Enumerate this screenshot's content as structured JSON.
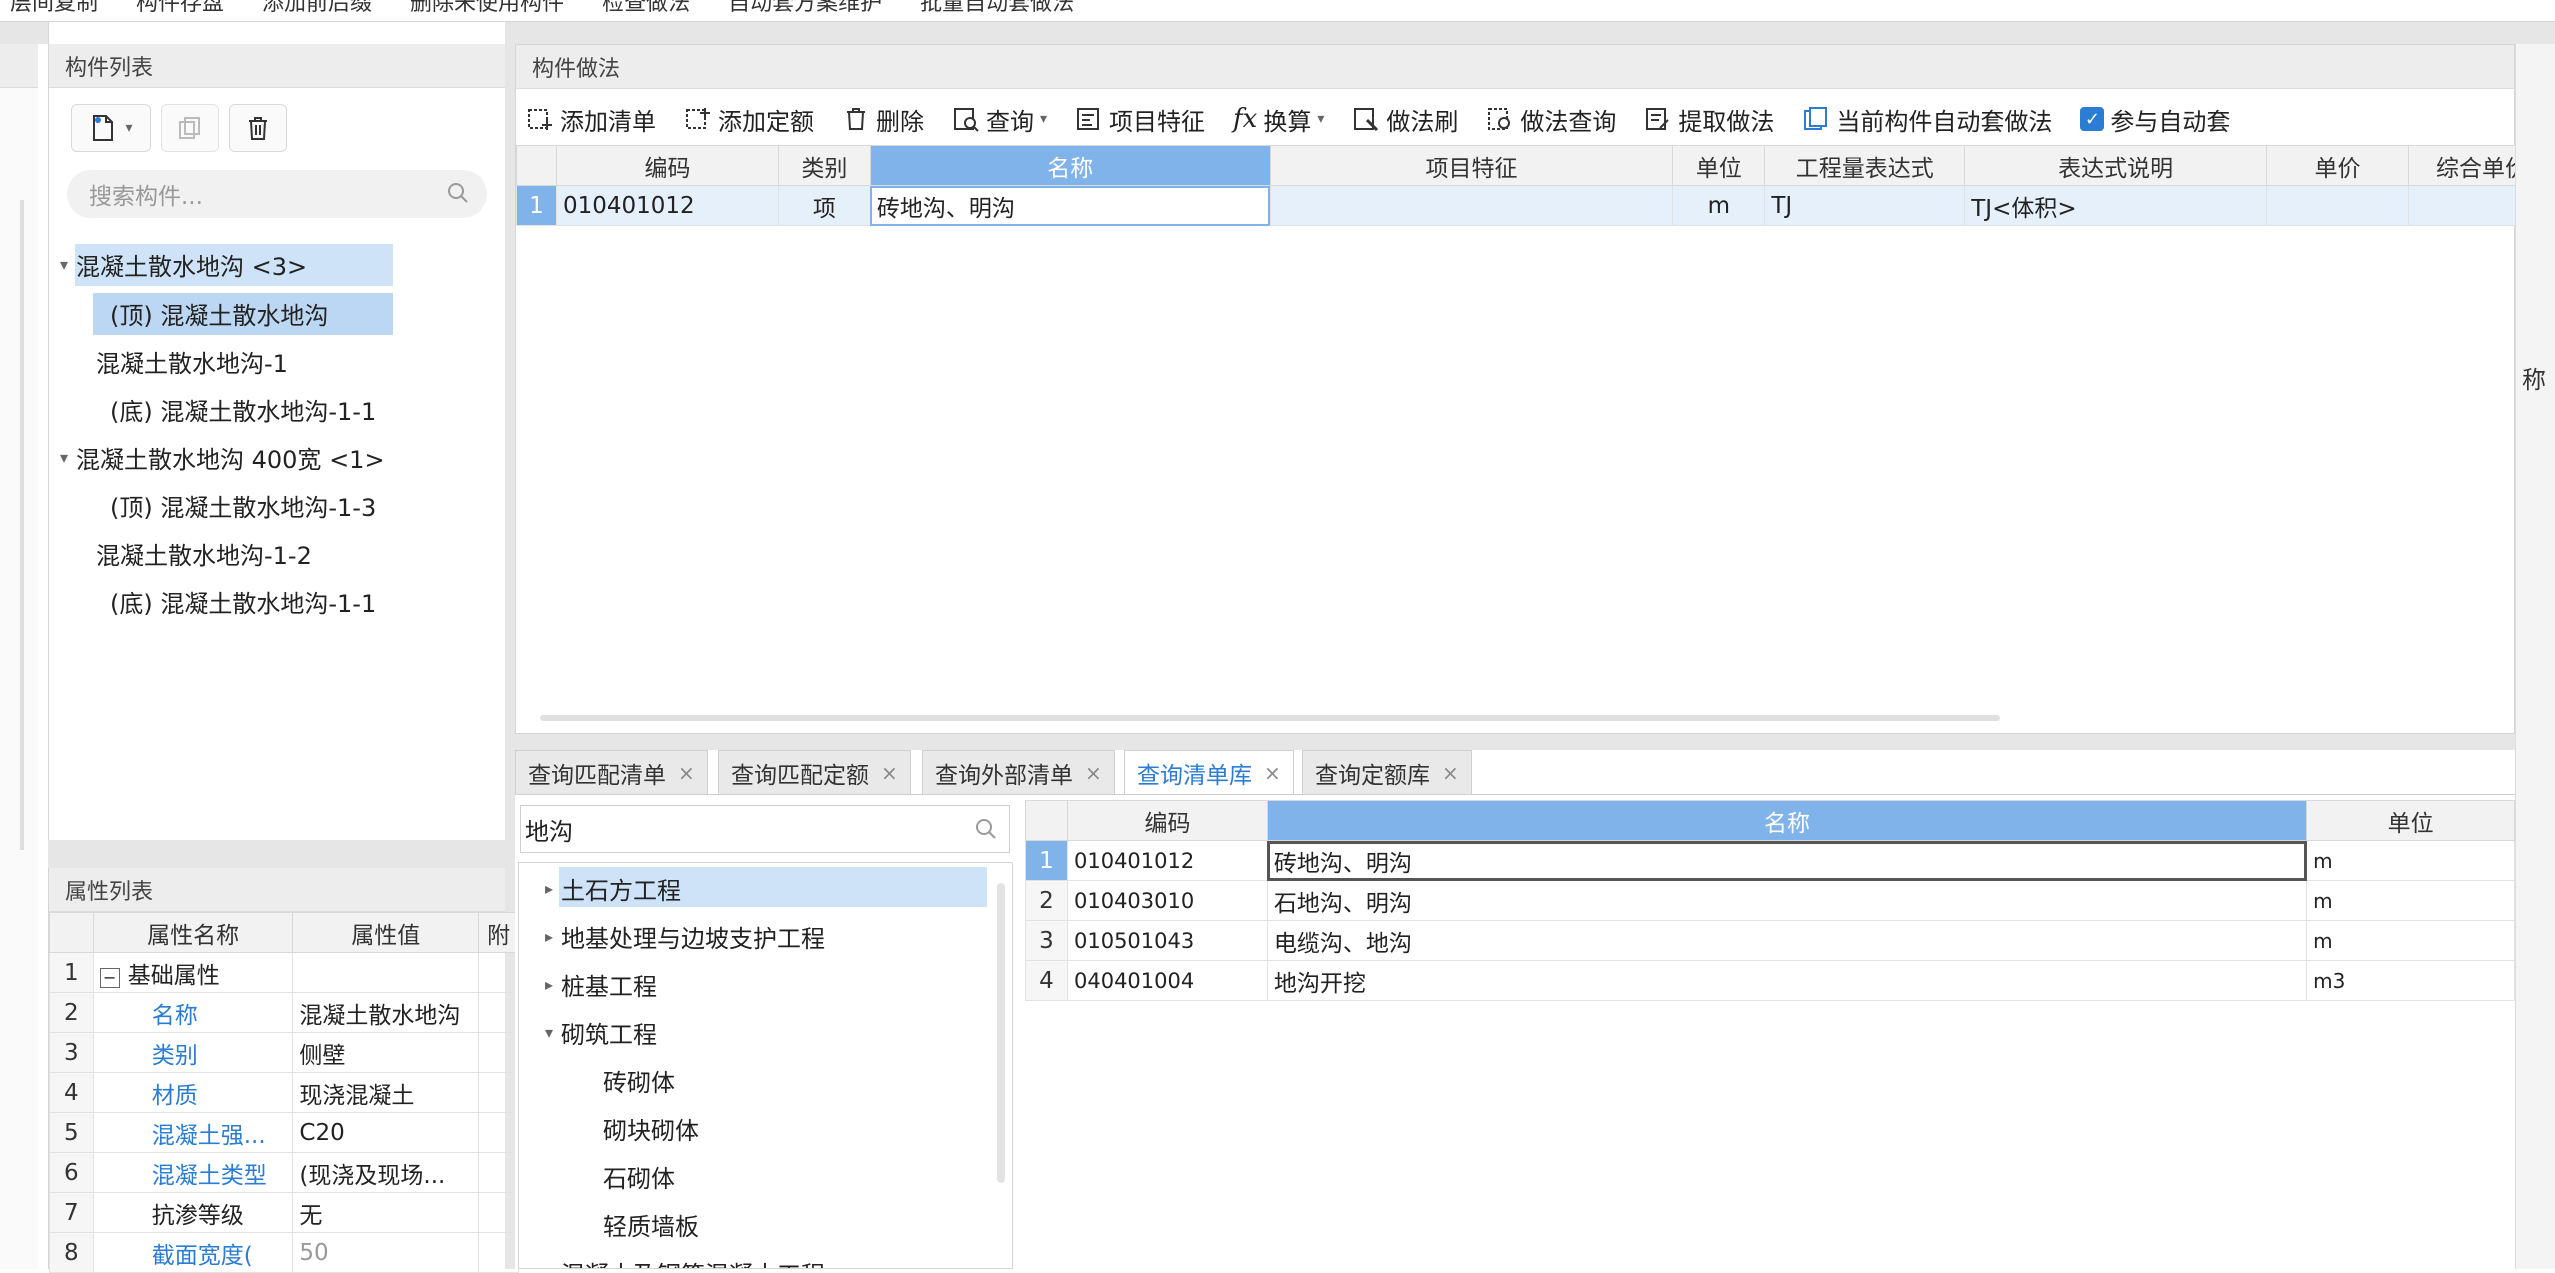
{
  "top_toolbar": {
    "items": [
      "层间复制",
      "构件存盘",
      "添加前后缀",
      "删除未使用构件",
      "检查做法",
      "自动套方案维护",
      "批量自动套做法"
    ]
  },
  "component_list": {
    "title": "构件列表",
    "search_placeholder": "搜索构件...",
    "tree": [
      {
        "label": "混凝土散水地沟 <3>",
        "level": 0,
        "expanded": true,
        "selected": true
      },
      {
        "label": "(顶) 混凝土散水地沟",
        "level": 1,
        "selected": true
      },
      {
        "label": "混凝土散水地沟-1",
        "level": 1
      },
      {
        "label": "(底) 混凝土散水地沟-1-1",
        "level": 1
      },
      {
        "label": "混凝土散水地沟 400宽 <1>",
        "level": 0,
        "expanded": true
      },
      {
        "label": "(顶) 混凝土散水地沟-1-3",
        "level": 1
      },
      {
        "label": "混凝土散水地沟-1-2",
        "level": 1
      },
      {
        "label": "(底) 混凝土散水地沟-1-1",
        "level": 1
      }
    ]
  },
  "property_list": {
    "title": "属性列表",
    "headers": [
      "属性名称",
      "属性值",
      "附"
    ],
    "rows": [
      {
        "num": "1",
        "name": "基础属性",
        "value": "",
        "group": true
      },
      {
        "num": "2",
        "name": "名称",
        "value": "混凝土散水地沟",
        "blue": true
      },
      {
        "num": "3",
        "name": "类别",
        "value": "侧壁",
        "blue": true
      },
      {
        "num": "4",
        "name": "材质",
        "value": "现浇混凝土",
        "blue": true
      },
      {
        "num": "5",
        "name": "混凝土强...",
        "value": "C20",
        "blue": true
      },
      {
        "num": "6",
        "name": "混凝土类型",
        "value": "(现浇及现场...",
        "blue": true
      },
      {
        "num": "7",
        "name": "抗渗等级",
        "value": "无",
        "blue": false
      },
      {
        "num": "8",
        "name": "截面宽度(",
        "value": "50",
        "blue": true
      }
    ]
  },
  "method_panel": {
    "title": "构件做法",
    "toolbar": [
      "添加清单",
      "添加定额",
      "删除",
      "查询",
      "项目特征",
      "换算",
      "做法刷",
      "做法查询",
      "提取做法",
      "当前构件自动套做法",
      "参与自动套"
    ],
    "headers": [
      "编码",
      "类别",
      "名称",
      "项目特征",
      "单位",
      "工程量表达式",
      "表达式说明",
      "单价",
      "综合单价"
    ],
    "rows": [
      {
        "num": "1",
        "code": "010401012",
        "type": "项",
        "name": "砖地沟、明沟",
        "feature": "",
        "unit": "m",
        "expr": "TJ",
        "desc": "TJ<体积>",
        "price": "",
        "total": ""
      }
    ]
  },
  "side_fragment": "称",
  "query_tabs": [
    "查询匹配清单",
    "查询匹配定额",
    "查询外部清单",
    "查询清单库",
    "查询定额库"
  ],
  "active_tab_index": 3,
  "query_search_value": "地沟",
  "category_tree": [
    {
      "label": "土石方工程",
      "level": 0,
      "caret": "right",
      "selected": true
    },
    {
      "label": "地基处理与边坡支护工程",
      "level": 0,
      "caret": "right"
    },
    {
      "label": "桩基工程",
      "level": 0,
      "caret": "right"
    },
    {
      "label": "砌筑工程",
      "level": 0,
      "caret": "down"
    },
    {
      "label": "砖砌体",
      "level": 1
    },
    {
      "label": "砌块砌体",
      "level": 1
    },
    {
      "label": "石砌体",
      "level": 1
    },
    {
      "label": "轻质墙板",
      "level": 1
    },
    {
      "label": "混凝土及钢筋混凝土工程",
      "level": 0,
      "caret": "right"
    }
  ],
  "result_table": {
    "headers": [
      "编码",
      "名称",
      "单位"
    ],
    "rows": [
      {
        "num": "1",
        "code": "010401012",
        "name": "砖地沟、明沟",
        "unit": "m"
      },
      {
        "num": "2",
        "code": "010403010",
        "name": "石地沟、明沟",
        "unit": "m"
      },
      {
        "num": "3",
        "code": "010501043",
        "name": "电缆沟、地沟",
        "unit": "m"
      },
      {
        "num": "4",
        "code": "040401004",
        "name": "地沟开挖",
        "unit": "m3"
      }
    ]
  },
  "colors": {
    "accent": "#2b7cd3",
    "selected_bg": "#cfe3f8",
    "header_selected": "#7fb3ea"
  }
}
